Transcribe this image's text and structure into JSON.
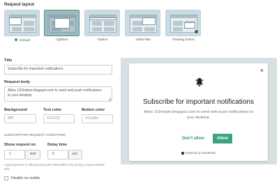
{
  "section_title": "Request layout",
  "layouts": [
    {
      "name": "Default",
      "selected": false,
      "active": true
    },
    {
      "name": "Lightbox",
      "selected": true,
      "active": false
    },
    {
      "name": "Topline",
      "selected": false,
      "active": false
    },
    {
      "name": "Safari-like",
      "selected": false,
      "active": false
    },
    {
      "name": "Floating button",
      "selected": false,
      "active": false
    }
  ],
  "title_field": {
    "label": "Title",
    "value": "Subscribe for important notifications"
  },
  "body_field": {
    "label": "Request body",
    "value": "Allow 101helper.blogspot.com to send web push notifications to your desktop."
  },
  "colors": {
    "background": {
      "label": "Background",
      "value": "ffffff"
    },
    "text": {
      "label": "Text color",
      "value": "#222222"
    },
    "button": {
      "label": "Button color",
      "value": "#31a58e"
    }
  },
  "conditions": {
    "heading": "SUBSCRIPTION REQUEST CONDITIONS",
    "show_on": {
      "label": "Show request on",
      "value": "1",
      "unit": "visit"
    },
    "delay": {
      "label": "Delay time",
      "value": "0",
      "unit": "sec."
    },
    "hint": "A good practice is offering web push subscription only during a repeat website visit."
  },
  "disable_mobile": {
    "label": "Disable on mobile",
    "checked": false
  },
  "preview": {
    "title": "Subscribe for important notifications",
    "body": "Allow 101helper.blogspot.com to send web push notifications to your desktop.",
    "deny_label": "Don't allow",
    "allow_label": "Allow",
    "powered": "Powered by SendPulse",
    "close_glyph": "×",
    "accent": "#3ba383"
  }
}
